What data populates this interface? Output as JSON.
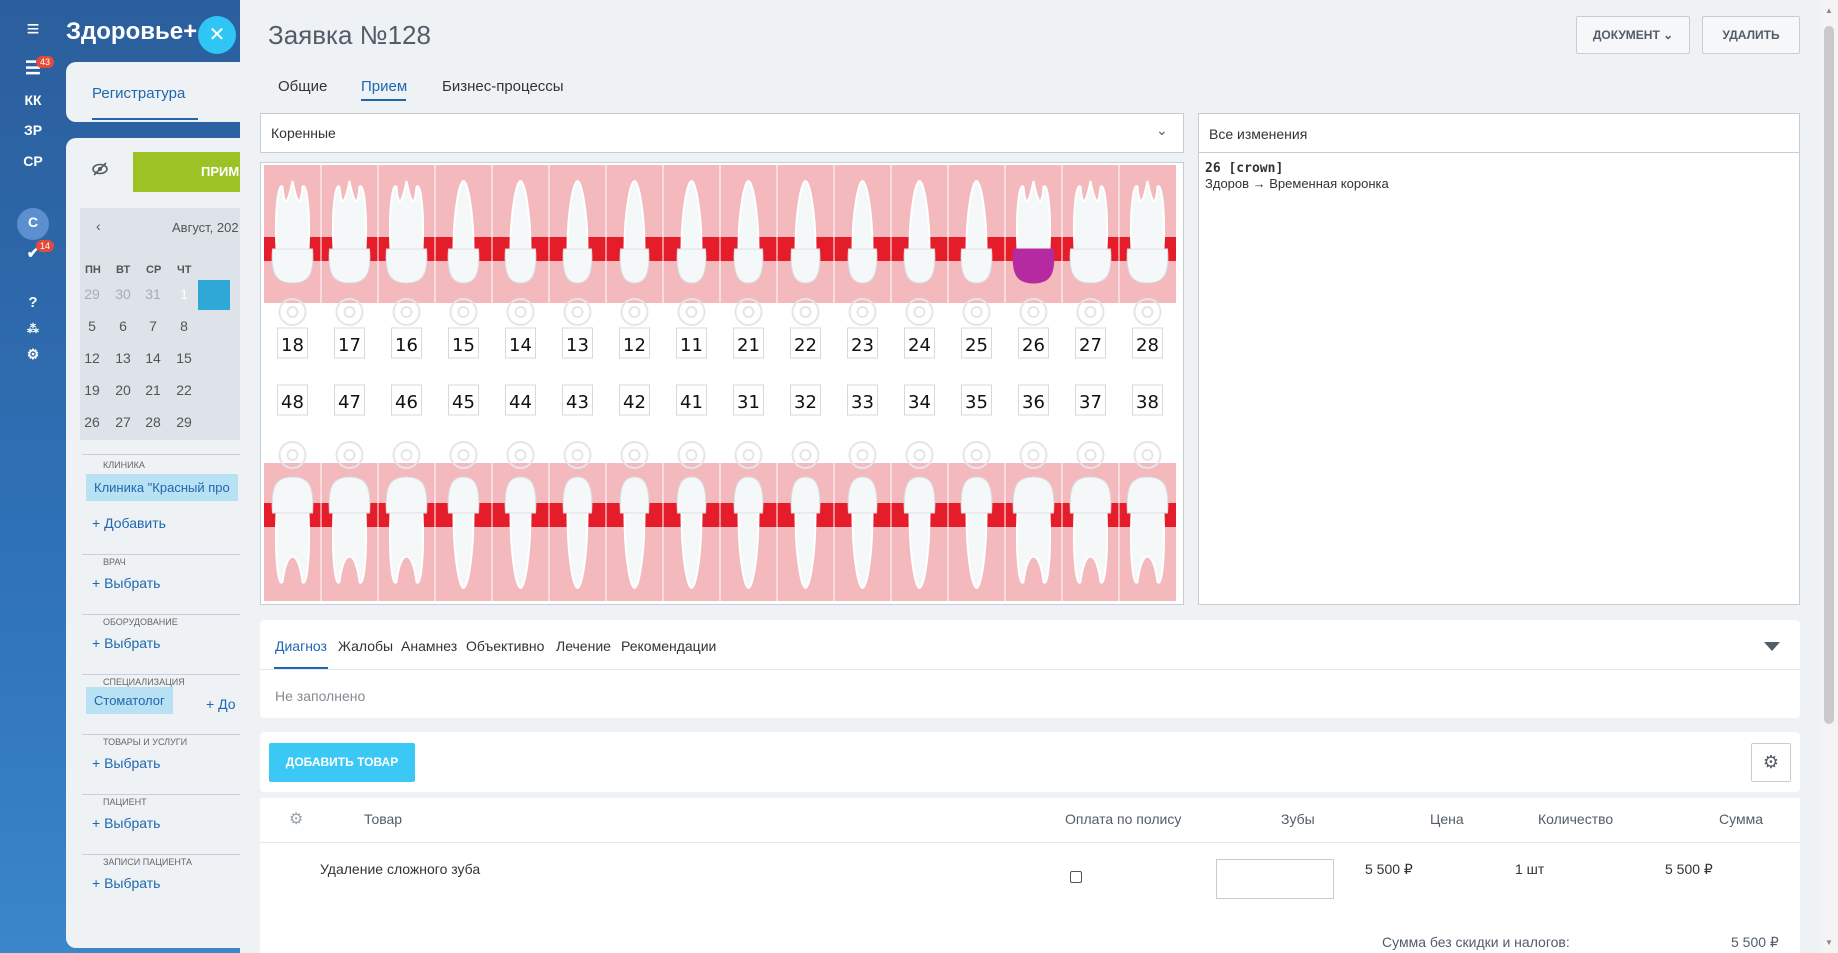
{
  "app": {
    "brand": "Здоровье+",
    "rail": [
      {
        "label": "КК"
      },
      {
        "label": "ЗР"
      },
      {
        "label": "СР"
      },
      {
        "label": "С"
      }
    ],
    "rail_badges": [
      "43",
      "14"
    ],
    "tab": "Регистратура",
    "apply_partial": "ПРИМ",
    "calendar_title": "Август, 202",
    "weekdays": [
      "ПН",
      "ВТ",
      "СР",
      "ЧТ"
    ],
    "calendar_rows": [
      [
        "29",
        "30",
        "31",
        "1"
      ],
      [
        "5",
        "6",
        "7",
        "8"
      ],
      [
        "12",
        "13",
        "14",
        "15"
      ],
      [
        "19",
        "20",
        "21",
        "22"
      ],
      [
        "26",
        "27",
        "28",
        "29"
      ]
    ],
    "fields": {
      "clinic_label": "КЛИНИКА",
      "clinic_chip": "Клиника \"Красный про",
      "clinic_add": "+ Добавить",
      "doctor_label": "ВРАЧ",
      "doctor_link": "+ Выбрать",
      "equipment_label": "ОБОРУДОВАНИЕ",
      "equipment_link": "+ Выбрать",
      "spec_label": "СПЕЦИАЛИЗАЦИЯ",
      "spec_chip": "Стоматолог",
      "spec_add": "+ До",
      "goods_label": "ТОВАРЫ И УСЛУГИ",
      "goods_link": "+ Выбрать",
      "patient_label": "ПАЦИЕНТ",
      "patient_link": "+ Выбрать",
      "records_label": "ЗАПИСИ ПАЦИЕНТА",
      "records_link": "+ Выбрать"
    }
  },
  "slider": {
    "title": "Заявка №128",
    "doc_button": "ДОКУМЕНТ",
    "delete_button": "УДАЛИТЬ",
    "tabs": [
      "Общие",
      "Прием",
      "Бизнес-процессы"
    ],
    "active_tab": "Прием",
    "teeth_select": "Коренные",
    "changes_header": "Все изменения",
    "changes": [
      {
        "title": "26 [crown]",
        "detail": "Здоров → Временная коронка"
      }
    ],
    "upper_teeth": [
      "18",
      "17",
      "16",
      "15",
      "14",
      "13",
      "12",
      "11",
      "21",
      "22",
      "23",
      "24",
      "25",
      "26",
      "27",
      "28"
    ],
    "lower_teeth": [
      "48",
      "47",
      "46",
      "45",
      "44",
      "43",
      "42",
      "41",
      "31",
      "32",
      "33",
      "34",
      "35",
      "36",
      "37",
      "38"
    ],
    "crown_tooth": "26",
    "colors": {
      "gum": "#f3b9bd",
      "gum_line": "#e51d2a",
      "tooth": "#f4f8f9",
      "crown": "#b52aa0",
      "accent": "#2067b0",
      "button_blue": "#3bc8f5"
    },
    "subtabs": [
      "Диагноз",
      "Жалобы",
      "Анамнез",
      "Объективно",
      "Лечение",
      "Рекомендации"
    ],
    "active_subtab": "Диагноз",
    "empty_note": "Не заполнено",
    "add_product": "ДОБАВИТЬ ТОВАР",
    "table": {
      "headers": [
        "Товар",
        "Оплата по полису",
        "Зубы",
        "Цена",
        "Количество",
        "Сумма"
      ],
      "rows": [
        {
          "product": "Удаление сложного зуба",
          "price": "5 500 ₽",
          "qty": "1 шт",
          "sum": "5 500 ₽"
        }
      ],
      "total_label": "Сумма без скидки и налогов:",
      "total_value": "5 500 ₽"
    }
  }
}
